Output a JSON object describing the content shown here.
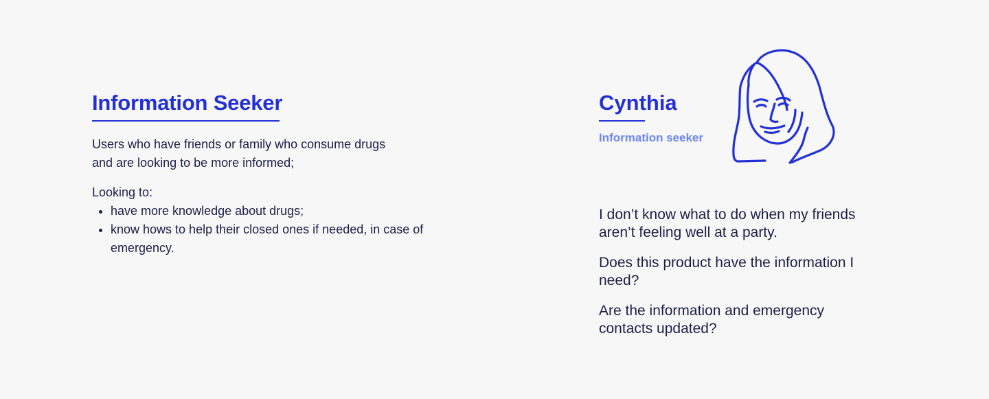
{
  "segment": {
    "title": "Information Seeker",
    "description_line1": "Users who have friends or family who consume drugs",
    "description_line2": "and are looking to be more informed;",
    "looking_heading": "Looking to:",
    "goals": [
      "have more knowledge about drugs;",
      "know hows to help their closed ones if needed, in case of emergency."
    ]
  },
  "persona": {
    "name": "Cynthia",
    "role": "Information seeker",
    "avatar_icon": "woman-portrait-line-icon",
    "quotes": [
      "I don’t know what to do when my friends aren’t feeling well at a party.",
      "Does this product have the information I need?",
      "Are the information and emergency contacts updated?"
    ]
  },
  "colors": {
    "accent": "#2230d6",
    "accent_light": "#6d87ec",
    "text": "#1c1f45",
    "background": "#f7f7f8"
  }
}
